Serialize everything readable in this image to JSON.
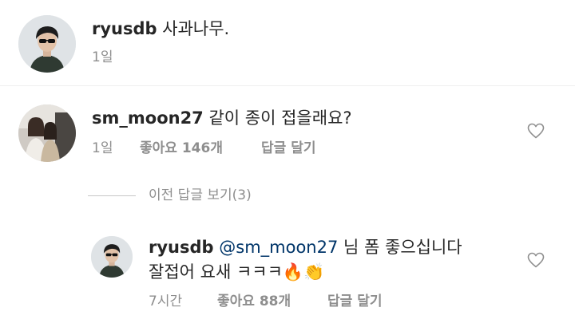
{
  "caption": {
    "username": "ryusdb",
    "text": "사과나무.",
    "time": "1일"
  },
  "comment": {
    "username": "sm_moon27",
    "text": "같이 종이 접을래요?",
    "time": "1일",
    "likes_label": "좋아요 146개",
    "reply_label": "답글 달기",
    "like_icon": "heart-outline-icon"
  },
  "view_replies": {
    "label": "이전 답글 보기(3)"
  },
  "reply": {
    "username": "ryusdb",
    "mention": "@sm_moon27",
    "text_line1": "님 폼 좋으십니다",
    "text_line2": "잘접어 요새 ㅋㅋㅋ🔥👏",
    "time": "7시간",
    "likes_label": "좋아요 88개",
    "reply_label": "답글 달기",
    "like_icon": "heart-outline-icon"
  },
  "colors": {
    "text": "#262626",
    "secondary": "#8e8e8e",
    "mention": "#003569",
    "divider": "#efefef"
  }
}
